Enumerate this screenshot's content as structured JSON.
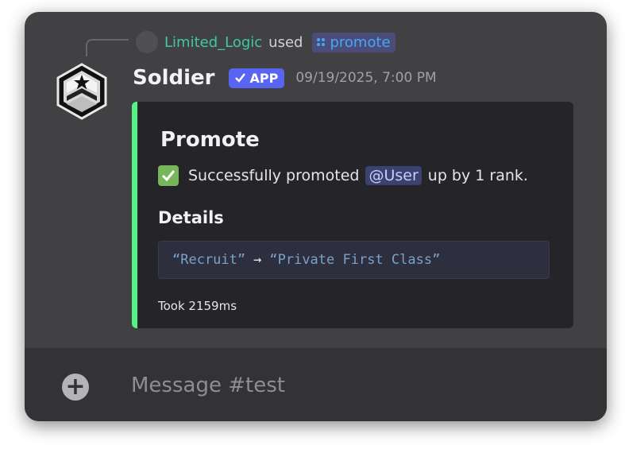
{
  "reply": {
    "username": "Limited_Logic",
    "used_text": "used",
    "command": "promote"
  },
  "message": {
    "username": "Soldier",
    "app_badge": "APP",
    "timestamp": "09/19/2025, 7:00 PM"
  },
  "embed": {
    "accent_color": "#57f287",
    "title": "Promote",
    "description_prefix": "Successfully promoted",
    "mention": "@User",
    "description_suffix": "up by 1 rank.",
    "field_name": "Details",
    "code_from": "“Recruit”",
    "code_arrow": "→",
    "code_to": "“Private First Class”",
    "footer": "Took 2159ms"
  },
  "composer": {
    "placeholder": "Message #test"
  },
  "icons": {
    "avatar": "military-rank-insignia-icon",
    "command": "slash-command-icon",
    "check": "check-mark-icon",
    "attach": "plus-circle-icon"
  }
}
